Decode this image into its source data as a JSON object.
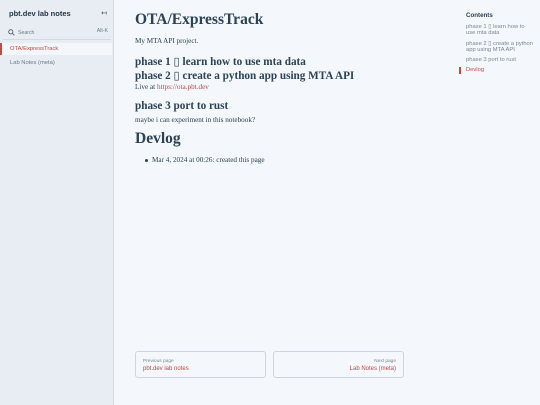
{
  "sidebar": {
    "title": "pbt.dev lab notes",
    "collapse_icon": "↤",
    "search": {
      "placeholder": "Search",
      "shortcut": "Alt-K",
      "icon": "search-icon"
    },
    "items": [
      {
        "label": "OTA/ExpressTrack",
        "active": true
      },
      {
        "label": "Lab Notes (meta)",
        "active": false
      }
    ]
  },
  "main": {
    "title": "OTA/ExpressTrack",
    "description": "My MTA API project.",
    "phase1": "phase 1 ▯ learn how to use mta data",
    "phase2": "phase 2 ▯ create a python app using MTA API",
    "live_prefix": "Live at ",
    "live_link": "https://ota.pbt.dev",
    "phase3": "phase 3 port to rust",
    "phase3_text": "maybe i can experiment in this notebook?",
    "devlog_heading": "Devlog",
    "devlog_items": [
      "Mar 4, 2024 at 00:26: created this page"
    ]
  },
  "pager": {
    "prev_label": "Previous page",
    "prev_title": "pbt.dev lab notes",
    "next_label": "Next page",
    "next_title": "Lab Notes (meta)"
  },
  "toc": {
    "title": "Contents",
    "items": [
      {
        "label": "phase 1 ▯ learn how to use mta data",
        "active": false
      },
      {
        "label": "phase 2 ▯ create a python app using MTA API",
        "active": false
      },
      {
        "label": "phase 3 port to rust",
        "active": false
      },
      {
        "label": "Devlog",
        "active": true
      }
    ]
  },
  "colors": {
    "accent": "#c4493f",
    "text": "#2b4257",
    "background": "#f4f7fb",
    "sidebar_bg": "#e8edf3"
  }
}
